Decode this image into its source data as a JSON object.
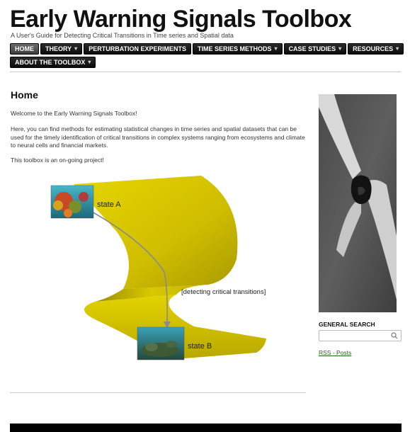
{
  "site": {
    "title": "Early Warning Signals Toolbox",
    "tagline": "A User's Guide for Detecting Critical Transitions in Time series and Spatial data"
  },
  "nav": {
    "row1": [
      {
        "label": "HOME",
        "has_dropdown": false,
        "active": true
      },
      {
        "label": "THEORY",
        "has_dropdown": true,
        "active": false
      },
      {
        "label": "PERTURBATION EXPERIMENTS",
        "has_dropdown": false,
        "active": false
      },
      {
        "label": "TIME SERIES METHODS",
        "has_dropdown": true,
        "active": false
      },
      {
        "label": "CASE STUDIES",
        "has_dropdown": true,
        "active": false
      },
      {
        "label": "RESOURCES",
        "has_dropdown": true,
        "active": false
      }
    ],
    "row2": [
      {
        "label": "ABOUT THE TOOLBOX",
        "has_dropdown": true,
        "active": false
      }
    ],
    "dropdown_glyph": "▾"
  },
  "main": {
    "page_title": "Home",
    "welcome": "Welcome to the Early Warning Signals Toolbox!",
    "intro": "Here, you can find methods for estimating statistical changes in time series and spatial datasets that can be used for the timely identification of critical transitions in complex systems ranging from ecosystems and climate to neural cells and financial markets.",
    "ongoing": "This toolbox is an on-going project!",
    "diagram": {
      "state_a": "state A",
      "state_b": "state B",
      "caption": "[detecting critical transitions]"
    }
  },
  "sidebar": {
    "search_label": "GENERAL SEARCH",
    "search_value": "",
    "search_placeholder": "",
    "search_icon": "magnifier-icon",
    "rss_label": "RSS - Posts"
  },
  "colors": {
    "nav_bg": "#111111",
    "nav_active_bg": "#4a4a4a",
    "fold_yellow": "#d4c400",
    "link_green": "#2a5a1a"
  }
}
